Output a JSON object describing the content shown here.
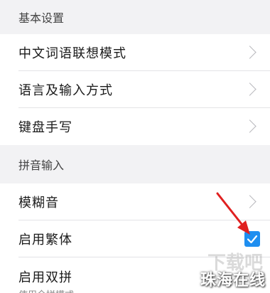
{
  "sections": {
    "basic": {
      "header": "基本设置",
      "items": [
        {
          "label": "中文词语联想模式"
        },
        {
          "label": "语言及输入方式"
        },
        {
          "label": "键盘手写"
        }
      ]
    },
    "pinyin": {
      "header": "拼音输入",
      "items": [
        {
          "label": "模糊音"
        },
        {
          "label": "启用繁体",
          "checked": true
        },
        {
          "label": "启用双拼",
          "subtitle": "使用全拼模式"
        }
      ]
    }
  },
  "colors": {
    "accent": "#1e8ef0",
    "annotation_arrow": "#e02020"
  },
  "watermark": {
    "text": "珠海在线",
    "site_mark": "下载吧"
  }
}
